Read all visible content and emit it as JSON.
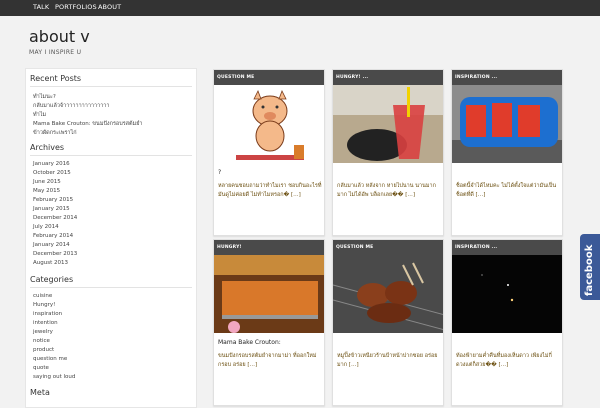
{
  "nav": {
    "items": [
      {
        "label": "TALK"
      },
      {
        "label": "PORTFOLIOS"
      },
      {
        "label": "ABOUT"
      }
    ]
  },
  "site": {
    "title": "about v",
    "tagline": "MAY I INSPIRE U"
  },
  "sidebar": {
    "recent_posts": {
      "title": "Recent Posts",
      "items": [
        {
          "label": "ทำไมนะ?"
        },
        {
          "label": "กลับมาแล้วจ้าาาาาาาาาาาาาาา"
        },
        {
          "label": "ทำไม"
        },
        {
          "label": "Mama Bake Crouton: ขนมปังกรอบรสต้มยำ"
        },
        {
          "label": "ข้าวผัดกระเพราไก่"
        }
      ]
    },
    "archives": {
      "title": "Archives",
      "items": [
        {
          "label": "January 2016"
        },
        {
          "label": "October 2015"
        },
        {
          "label": "June 2015"
        },
        {
          "label": "May 2015"
        },
        {
          "label": "February 2015"
        },
        {
          "label": "January 2015"
        },
        {
          "label": "December 2014"
        },
        {
          "label": "July 2014"
        },
        {
          "label": "February 2014"
        },
        {
          "label": "January 2014"
        },
        {
          "label": "December 2013"
        },
        {
          "label": "August 2013"
        }
      ]
    },
    "categories": {
      "title": "Categories",
      "items": [
        {
          "label": "cuisine"
        },
        {
          "label": "Hungry!"
        },
        {
          "label": "inspiration"
        },
        {
          "label": "intention"
        },
        {
          "label": "jewelry"
        },
        {
          "label": "notice"
        },
        {
          "label": "product"
        },
        {
          "label": "question me"
        },
        {
          "label": "quote"
        },
        {
          "label": "saying out loud"
        }
      ]
    },
    "meta": {
      "title": "Meta"
    }
  },
  "posts": [
    {
      "category": "QUESTION ME",
      "title": "?",
      "excerpt": "หลายคนชอบถามว่าทำไมเรา ชอบกินอะไรที่มันดูไม่ค่อยดี ไม่ทำไมหรอก� […]"
    },
    {
      "category": "HUNGRY!   ...",
      "title": "",
      "excerpt": "กลับมาแล้ว หลังจาก หายไปนาน นานมาก มาก ไม่ได้อัพ บล็อกเลย�� […]"
    },
    {
      "category": "INSPIRATION   ...",
      "title": "",
      "excerpt": "ช็อตนี้จำได้ไหมคะ ไม่ได้ตั้งใจแต่ว่ามันเป็น ช็อตที่ดี […]"
    },
    {
      "category": "HUNGRY!",
      "title": "Mama Bake Crouton:",
      "excerpt": "ขนมปังกรอบรสต้มยำจากมาม่า ที่ออกใหม่ กรอบ อร่อย […]"
    },
    {
      "category": "QUESTION ME",
      "title": "",
      "excerpt": "หมูปิ้งข้าวเหนียวร้านป้าหน้าปากซอย อร่อยมาก […]"
    },
    {
      "category": "INSPIRATION   ...",
      "title": "",
      "excerpt": "ท้องฟ้ายามค่ำคืนที่มองเห็นดาว เพียงไม่กี่ดวงแต่ก็สวย�� […]"
    }
  ],
  "facebook": {
    "label": "facebook"
  },
  "colors": {
    "topbar": "#333333",
    "card_header": "#4a4a4a",
    "excerpt": "#6b4f10",
    "facebook": "#3b5998"
  }
}
